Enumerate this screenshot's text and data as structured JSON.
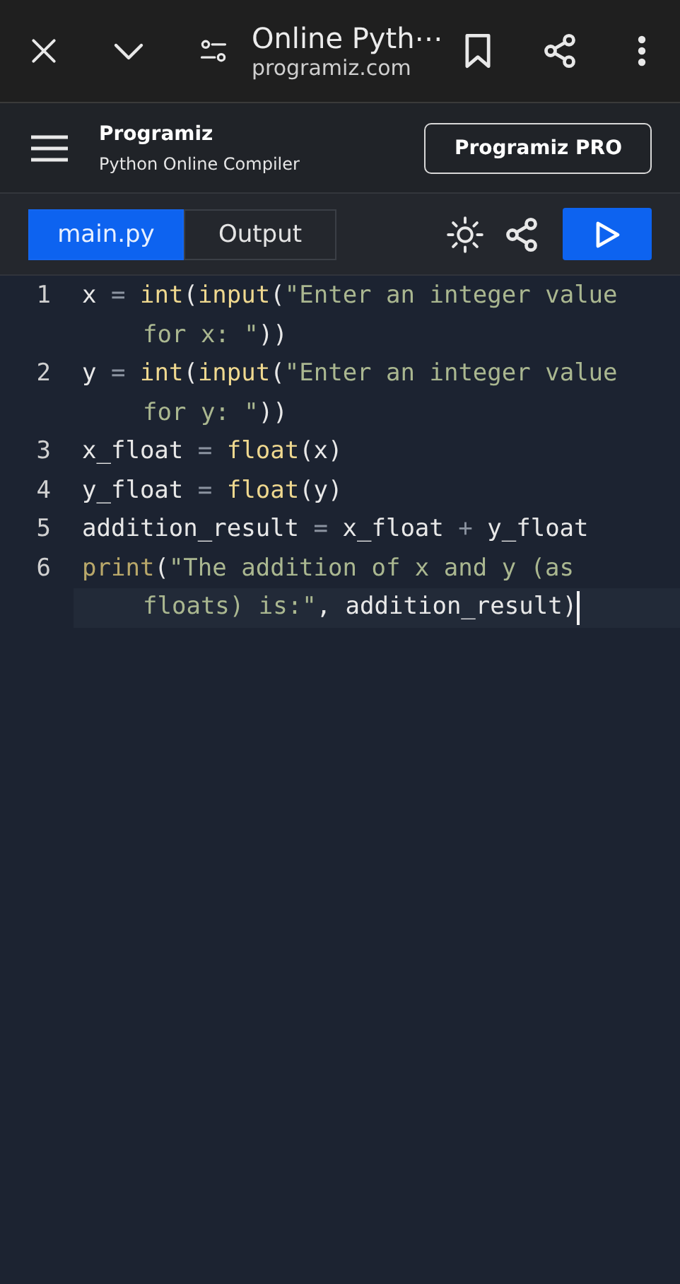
{
  "browser_bar": {
    "title": "Online Pyth⋯",
    "url": "programiz.com"
  },
  "header": {
    "logo": "Programiz",
    "subtitle": "Python Online Compiler",
    "pro_button": "Programiz PRO"
  },
  "tabs": [
    {
      "label": "main.py",
      "selected": true
    },
    {
      "label": "Output",
      "selected": false
    }
  ],
  "editor": {
    "lines": [
      {
        "number": "1",
        "active": false,
        "rows": [
          {
            "tokens": [
              {
                "text": "x ",
                "kind": "name"
              },
              {
                "text": "= ",
                "kind": "op"
              },
              {
                "text": "int",
                "kind": "builtin"
              },
              {
                "text": "(",
                "kind": "name"
              },
              {
                "text": "input",
                "kind": "builtin"
              },
              {
                "text": "(",
                "kind": "name"
              },
              {
                "text": "\"Enter an integer value",
                "kind": "string"
              }
            ]
          },
          {
            "tokens": [
              {
                "text": "for x: \"",
                "kind": "string"
              },
              {
                "text": "))",
                "kind": "name"
              }
            ]
          }
        ]
      },
      {
        "number": "2",
        "active": false,
        "rows": [
          {
            "tokens": [
              {
                "text": "y ",
                "kind": "name"
              },
              {
                "text": "= ",
                "kind": "op"
              },
              {
                "text": "int",
                "kind": "builtin"
              },
              {
                "text": "(",
                "kind": "name"
              },
              {
                "text": "input",
                "kind": "builtin"
              },
              {
                "text": "(",
                "kind": "name"
              },
              {
                "text": "\"Enter an integer value",
                "kind": "string"
              }
            ]
          },
          {
            "tokens": [
              {
                "text": "for y: \"",
                "kind": "string"
              },
              {
                "text": "))",
                "kind": "name"
              }
            ]
          }
        ]
      },
      {
        "number": "3",
        "active": false,
        "rows": [
          {
            "tokens": [
              {
                "text": "x_float ",
                "kind": "name"
              },
              {
                "text": "= ",
                "kind": "op"
              },
              {
                "text": "float",
                "kind": "builtin"
              },
              {
                "text": "(x)",
                "kind": "name"
              }
            ]
          }
        ]
      },
      {
        "number": "4",
        "active": false,
        "rows": [
          {
            "tokens": [
              {
                "text": "y_float ",
                "kind": "name"
              },
              {
                "text": "= ",
                "kind": "op"
              },
              {
                "text": "float",
                "kind": "builtin"
              },
              {
                "text": "(y)",
                "kind": "name"
              }
            ]
          }
        ]
      },
      {
        "number": "5",
        "active": false,
        "rows": [
          {
            "tokens": [
              {
                "text": "addition_result ",
                "kind": "name"
              },
              {
                "text": "= ",
                "kind": "op"
              },
              {
                "text": "x_float ",
                "kind": "name"
              },
              {
                "text": "+ ",
                "kind": "op"
              },
              {
                "text": "y_float",
                "kind": "name"
              }
            ]
          }
        ]
      },
      {
        "number": "6",
        "active": true,
        "rows": [
          {
            "tokens": [
              {
                "text": "print",
                "kind": "keyword"
              },
              {
                "text": "(",
                "kind": "name"
              },
              {
                "text": "\"The addition of x and y (as",
                "kind": "string"
              }
            ]
          },
          {
            "tokens": [
              {
                "text": "floats) is:\"",
                "kind": "string"
              },
              {
                "text": ", addition_result)",
                "kind": "name"
              }
            ]
          }
        ]
      }
    ]
  }
}
